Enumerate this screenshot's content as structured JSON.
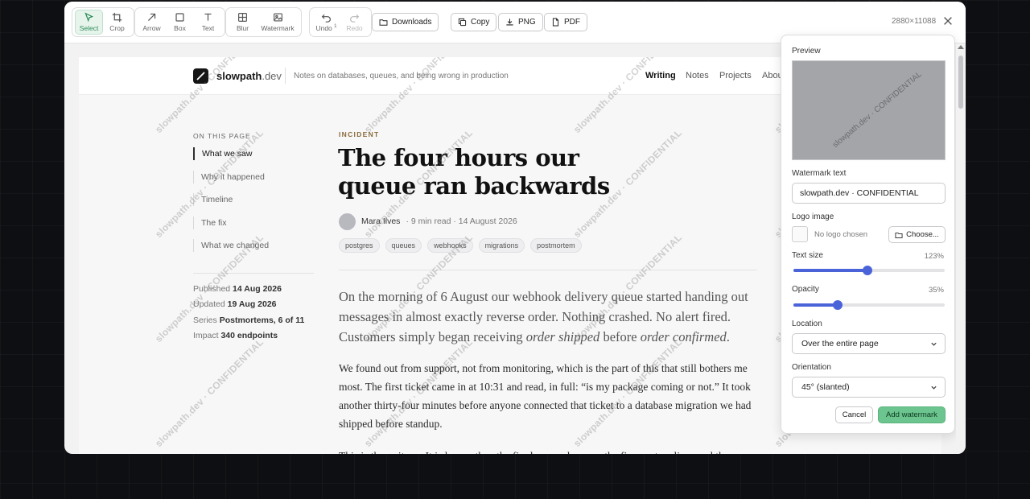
{
  "toolbar": {
    "tools": [
      {
        "label": "Select",
        "icon": "cursor-icon"
      },
      {
        "label": "Crop",
        "icon": "crop-icon"
      },
      {
        "label": "Arrow",
        "icon": "arrow-icon"
      },
      {
        "label": "Box",
        "icon": "box-icon"
      },
      {
        "label": "Text",
        "icon": "text-icon"
      },
      {
        "label": "Blur",
        "icon": "blur-icon"
      },
      {
        "label": "Watermark",
        "icon": "watermark-icon"
      }
    ],
    "undo_label": "Undo",
    "undo_count": "1",
    "redo_label": "Redo",
    "downloads_label": "Downloads",
    "copy_label": "Copy",
    "png_label": "PNG",
    "pdf_label": "PDF",
    "dimensions": "2880×11088"
  },
  "site": {
    "name": "slowpath",
    "tld": ".dev",
    "tagline": "Notes on databases, queues, and being wrong in production",
    "nav": [
      "Writing",
      "Notes",
      "Projects",
      "About"
    ]
  },
  "toc": {
    "title": "ON THIS PAGE",
    "items": [
      "What we saw",
      "Why it happened",
      "Timeline",
      "The fix",
      "What we changed"
    ]
  },
  "meta": {
    "published_label": "Published",
    "published": "14 Aug 2026",
    "updated_label": "Updated",
    "updated": "19 Aug 2026",
    "series_label": "Series",
    "series": "Postmortems, 6 of 11",
    "impact_label": "Impact",
    "impact": "340 endpoints"
  },
  "article": {
    "kicker": "INCIDENT",
    "title": "The four hours our queue ran backwards",
    "author": "Mara Ilves",
    "byline_rest": "· 9 min read · 14 August 2026",
    "tags": [
      "postgres",
      "queues",
      "webhooks",
      "migrations",
      "postmortem"
    ],
    "lede_1": "On the morning of 6 August our webhook delivery queue started handing out messages in almost exactly reverse order. Nothing crashed. No alert fired. Customers simply began receiving ",
    "lede_em1": "order shipped",
    "lede_2": " before ",
    "lede_em2": "order confirmed",
    "lede_3": ".",
    "p1": "We found out from support, not from monitoring, which is the part of this that still bothers me most. The first ticket came in at 10:31 and read, in full: “is my package coming or not.” It took another thirty-four minutes before anyone connected that ticket to a database migration we had shipped before standup.",
    "p2": "This is the writeup. It is longer than the fix deserves because the fix was two lines and the"
  },
  "watermark_text": "slowpath.dev · CONFIDENTIAL",
  "panel": {
    "preview_label": "Preview",
    "text_label": "Watermark text",
    "text_value": "slowpath.dev · CONFIDENTIAL",
    "logo_label": "Logo image",
    "no_logo": "No logo chosen",
    "choose_label": "Choose...",
    "size_label": "Text size",
    "size_value": "123%",
    "size_fraction": 0.49,
    "opacity_label": "Opacity",
    "opacity_value": "35%",
    "opacity_fraction": 0.29,
    "location_label": "Location",
    "location_value": "Over the entire page",
    "orientation_label": "Orientation",
    "orientation_value": "45° (slanted)",
    "cancel_label": "Cancel",
    "add_label": "Add watermark"
  },
  "colors": {
    "accent": "#4a63d9",
    "primary_button": "#6cc48e",
    "active_tool": "#2e8b57"
  }
}
